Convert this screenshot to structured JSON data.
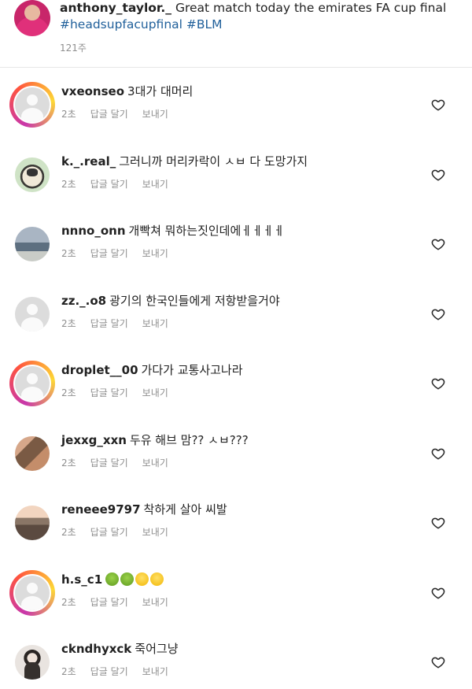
{
  "post": {
    "username": "anthony_taylor._",
    "text": "Great match today the emirates FA cup final",
    "hashtags": "#headsupfacupfinal #BLM",
    "age": "121주"
  },
  "actions": {
    "reply": "답글 달기",
    "send": "보내기"
  },
  "comments": [
    {
      "username": "vxeonseo",
      "text": "3대가 대머리",
      "age": "2초",
      "avatar": "default",
      "ring": true
    },
    {
      "username": "k._.real_",
      "text": "그러니까 머리카락이 ㅅㅂ 다 도망가지",
      "age": "2초",
      "avatar": "sheep",
      "ring": false
    },
    {
      "username": "nnno_onn",
      "text": "개빡쳐 뭐하는짓인데에ㅔㅔㅔㅔ",
      "age": "2초",
      "avatar": "sea",
      "ring": false
    },
    {
      "username": "zz._.o8",
      "text": "광기의 한국인들에게 저항받을거야",
      "age": "2초",
      "avatar": "default",
      "ring": false
    },
    {
      "username": "droplet__00",
      "text": "가다가 교통사고나라",
      "age": "2초",
      "avatar": "default",
      "ring": true
    },
    {
      "username": "jexxg_xxn",
      "text": "두유 해브 맘?? ㅅㅂ???",
      "age": "2초",
      "avatar": "room",
      "ring": false
    },
    {
      "username": "reneee9797",
      "text": "착하게 살아 씨발",
      "age": "2초",
      "avatar": "city",
      "ring": false
    },
    {
      "username": "h.s_c1",
      "text": "",
      "emojis": [
        "nauseated-face",
        "nauseated-face",
        "money-mouth-face",
        "money-mouth-face"
      ],
      "age": "2초",
      "avatar": "default",
      "ring": true
    },
    {
      "username": "ckndhyxck",
      "text": "죽어그냥",
      "age": "2초",
      "avatar": "girl",
      "ring": false
    }
  ],
  "icons": {
    "like": "heart-outline-icon"
  }
}
